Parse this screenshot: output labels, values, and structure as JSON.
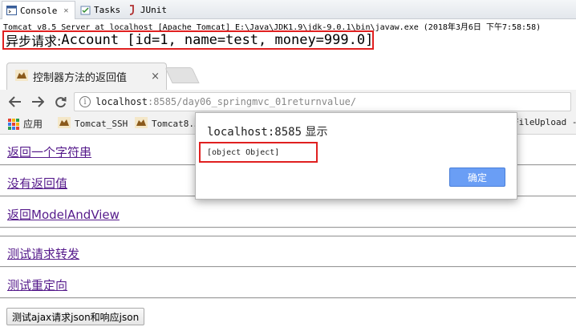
{
  "ide": {
    "tabs": [
      {
        "label": "Console",
        "close": "✕"
      },
      {
        "label": "Tasks"
      },
      {
        "label": "JUnit"
      }
    ],
    "console_header": "Tomcat v8.5 Server at localhost [Apache Tomcat] E:\\Java\\JDK1.9\\jdk-9.0.1\\bin\\javaw.exe (2018年3月6日 下午7:58:58)",
    "output_prefix": "异步请求:",
    "output_text": " Account [id=1, name=test, money=999.0]"
  },
  "browser": {
    "tab_title": "控制器方法的返回值",
    "tab_close": "×",
    "url_host": "localhost",
    "url_path": ":8585/day06_springmvc_01returnvalue/",
    "bookmarks": [
      "应用",
      "Tomcat_SSH",
      "Tomcat8.5",
      "FileUpload -"
    ]
  },
  "page": {
    "links": [
      "返回一个字符串",
      "没有返回值",
      "返回ModelAndView",
      "测试请求转发",
      "测试重定向"
    ],
    "ajax_button": "测试ajax请求json和响应json"
  },
  "dialog": {
    "title_host": "localhost:8585",
    "title_suffix": " 显示",
    "message": "[object Object]",
    "ok_label": "确定"
  },
  "colors": {
    "highlight": "#e02020",
    "link": "#551a8b",
    "ok_button": "#6a9ef5"
  }
}
